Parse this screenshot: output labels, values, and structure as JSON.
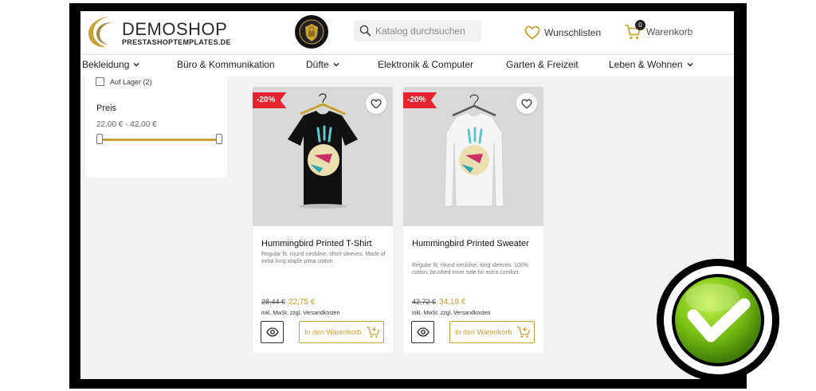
{
  "header": {
    "logo_name": "DEMOSHOP",
    "logo_subtitle": "PRESTASHOPTEMPLATES.DE",
    "search_placeholder": "Katalog durchsuchen",
    "wishlist_label": "Wunschlisten",
    "cart_label": "Warenkorb",
    "cart_count": "0"
  },
  "nav": {
    "items": [
      {
        "label": "Bekleidung",
        "has_dropdown": true
      },
      {
        "label": "Büro & Kommunikation",
        "has_dropdown": false
      },
      {
        "label": "Düfte",
        "has_dropdown": true
      },
      {
        "label": "Elektronik & Computer",
        "has_dropdown": false
      },
      {
        "label": "Garten & Freizeit",
        "has_dropdown": false
      },
      {
        "label": "Leben & Wohnen",
        "has_dropdown": true
      }
    ]
  },
  "filter": {
    "availability_option": "Auf Lager (2)",
    "availability_checked": false,
    "price_title": "Preis",
    "price_range": "22,00 € - 42,00 €"
  },
  "products": [
    {
      "discount": "-20%",
      "title": "Hummingbird Printed T-Shirt",
      "description": "Regular fit, round neckline, short sleeves. Made of extra long staple pima cotton.",
      "old_price": "28,44 €",
      "new_price": "22,75 €",
      "tax_note": "inkl. MwSt. zzgl. Versandkosten",
      "add_to_cart_label": "In den Warenkorb",
      "shirt_color": "#111111"
    },
    {
      "discount": "-20%",
      "title": "Hummingbird Printed Sweater",
      "description": "Regular fit, round neckline, long sleeves. 100% cotton, brushed inner side for extra comfort.",
      "old_price": "42,72 €",
      "new_price": "34,18 €",
      "tax_note": "inkl. MwSt. zzgl. Versandkosten",
      "add_to_cart_label": "In den Warenkorb",
      "shirt_color": "#f4f4f4"
    }
  ],
  "colors": {
    "accent_gold": "#c9a236",
    "discount_red": "#e6242f",
    "checkmark_green": "#7ac214"
  },
  "icons": [
    "search-icon",
    "heart-icon",
    "cart-icon",
    "chevron-down-icon",
    "eye-icon",
    "cart-plus-icon",
    "checkmark-icon"
  ]
}
